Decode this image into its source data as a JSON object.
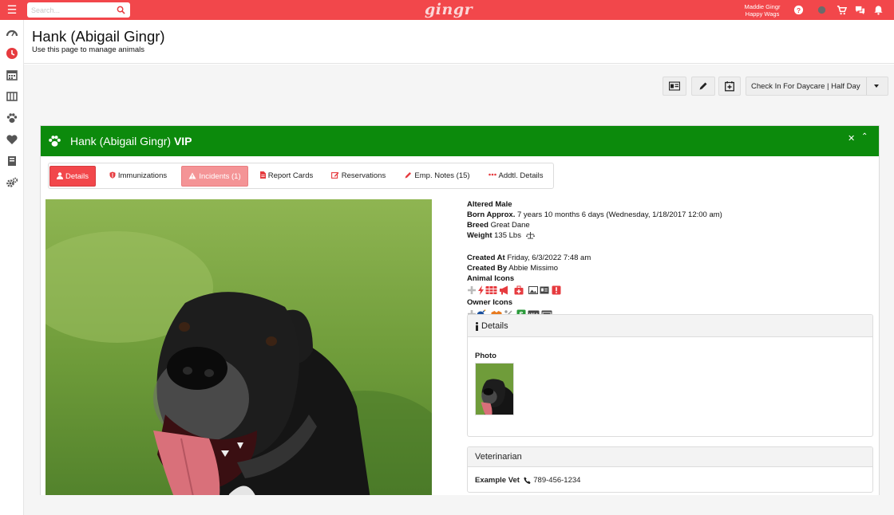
{
  "topbar": {
    "search_placeholder": "Search...",
    "logo": "gingr",
    "user_name": "Maddie Gingr",
    "business_name": "Happy Wags",
    "icons": [
      "hamburger-icon",
      "search-icon",
      "help-icon",
      "status-icon",
      "cart-icon",
      "chat-icon",
      "bell-icon"
    ],
    "bg_color": "#f2474b"
  },
  "sidebar": {
    "items": [
      {
        "icon": "dashboard-icon"
      },
      {
        "icon": "clock-icon"
      },
      {
        "icon": "calendar-icon"
      },
      {
        "icon": "columns-icon"
      },
      {
        "icon": "paw-icon"
      },
      {
        "icon": "heart-icon"
      },
      {
        "icon": "book-icon"
      },
      {
        "icon": "settings-icon"
      }
    ]
  },
  "page": {
    "title": "Hank (Abigail Gingr)",
    "subtitle": "Use this page to manage animals"
  },
  "toolbar": {
    "buttons": [
      "id-card-icon",
      "pencil-icon",
      "calendar-plus-icon"
    ],
    "checkin_label": "Check In For Daycare | Half Day"
  },
  "panel": {
    "title": "Hank (Abigail Gingr)",
    "badge": "VIP",
    "header_color": "#0c8a0c",
    "tabs": [
      {
        "label": "Details",
        "icon": "user-icon",
        "state": "active"
      },
      {
        "label": "Immunizations",
        "icon": "shield-icon",
        "state": "normal"
      },
      {
        "label": "Incidents (1)",
        "icon": "warning-icon",
        "state": "highlight"
      },
      {
        "label": "Report Cards",
        "icon": "file-icon",
        "state": "normal"
      },
      {
        "label": "Reservations",
        "icon": "edit-icon",
        "state": "normal"
      },
      {
        "label": "Emp. Notes (15)",
        "icon": "pencil-icon",
        "state": "normal"
      },
      {
        "label": "Addtl. Details",
        "icon": "ellipsis-icon",
        "state": "normal"
      }
    ]
  },
  "animal": {
    "sex": "Altered Male",
    "born_label": "Born Approx.",
    "born_value": "7 years 10 months 6 days (Wednesday, 1/18/2017 12:00 am)",
    "breed_label": "Breed",
    "breed_value": "Great Dane",
    "weight_label": "Weight",
    "weight_value": "135 Lbs",
    "created_at_label": "Created At",
    "created_at_value": "Friday, 6/3/2022 7:48 am",
    "created_by_label": "Created By",
    "created_by_value": "Abbie Missimo",
    "animal_icons_label": "Animal Icons",
    "owner_icons_label": "Owner Icons"
  },
  "details_card": {
    "title": "Details",
    "photo_label": "Photo"
  },
  "vet_card": {
    "title": "Veterinarian",
    "vet_name": "Example Vet",
    "vet_phone": "789-456-1234"
  }
}
